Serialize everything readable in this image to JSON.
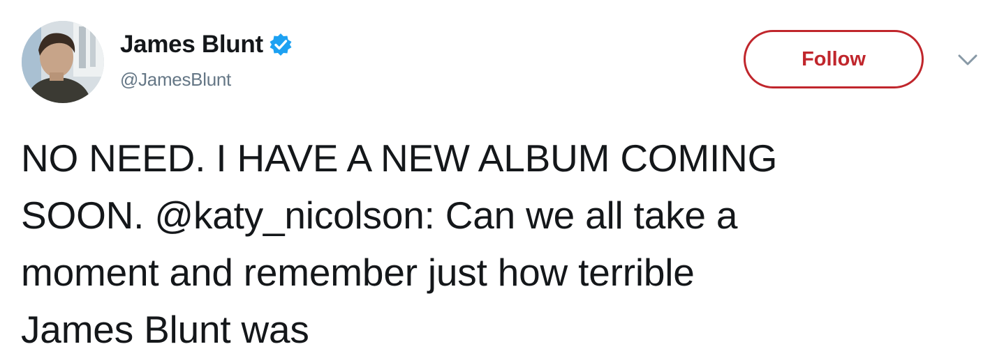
{
  "author": {
    "display_name": "James Blunt",
    "handle": "@JamesBlunt",
    "verified": true,
    "verified_icon": "verified-badge-icon",
    "avatar_icon": "profile-avatar"
  },
  "actions": {
    "follow_label": "Follow",
    "menu_icon": "chevron-down-icon"
  },
  "colors": {
    "accent": "#c0262c",
    "verified_blue": "#1da1f2",
    "secondary_text": "#657786",
    "primary_text": "#14171a"
  },
  "tweet": {
    "lines": [
      "NO NEED. I HAVE A NEW ALBUM COMING",
      "SOON. @katy_nicolson: Can we all take a",
      "moment and remember just how terrible",
      "James Blunt was"
    ]
  }
}
